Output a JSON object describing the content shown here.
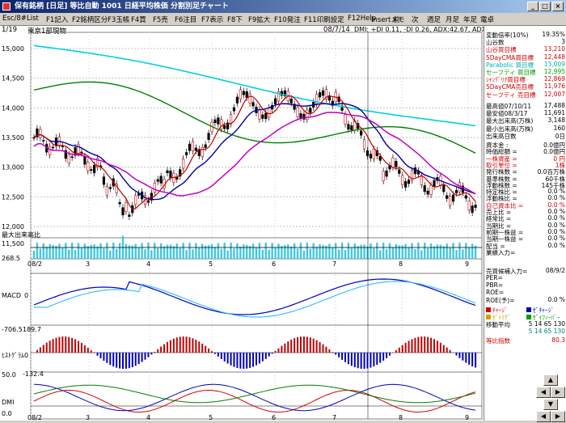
{
  "window": {
    "title": "保有銘柄 [日足] 等比自動  1001  日経平均株価 分割別足チャート"
  },
  "menu": [
    "Esc/8#",
    "List",
    "F1記入",
    "F2銘柄区分",
    "F3玉帳",
    "F4買",
    "F5売",
    "F6注目",
    "F7表示",
    "F8下",
    "F9拡大",
    "F10発注",
    "F11印刷設定",
    "F12Help",
    "Insertメモ",
    "前",
    "次",
    "週足",
    "月足",
    "年足",
    "電卓"
  ],
  "header": {
    "page": "1/19",
    "market": "東京1部現物",
    "date": "08/7/14",
    "dmi": "DMI: +DI 0.11, -DI 0.26, ADX:42.67, ADXR:33.58,"
  },
  "price_axis": {
    "ticks": [
      "15,000",
      "14,500",
      "14,000",
      "13,500",
      "13,000",
      "12,500",
      "12,000"
    ]
  },
  "volume_axis": {
    "label": "最大出来高比",
    "ticks": [
      "11,500",
      "268.5"
    ]
  },
  "macd": {
    "label": "MACD",
    "zero": "0",
    "low": "-706.5",
    "high": "189.7"
  },
  "hist": {
    "label": "ﾋｽﾄｸﾞﾗﾑ",
    "zero": "0",
    "low": "-132.4"
  },
  "dmi_panel": {
    "label": "DMI",
    "top": "50.0",
    "bottom": "0.0"
  },
  "date_axis": [
    "08/2",
    "3",
    "4",
    "5",
    "6",
    "7",
    "8",
    "9"
  ],
  "sidebar_top": [
    {
      "k": "変動倍率(10%)",
      "v": "19.35%",
      "c": "#000000"
    },
    {
      "k": "山谷数",
      "v": "3",
      "c": "#000000"
    },
    {
      "k": "山谷買目標",
      "v": "13,210",
      "c": "#d00000"
    },
    {
      "k": "5DayCMA買目標",
      "v": "12,448",
      "c": "#d00000"
    },
    {
      "k": "Parabolic 買目標",
      "v": "13,009",
      "c": "#00b0b0"
    },
    {
      "k": "セーフティ 買目標",
      "v": "12,995",
      "c": "#00a000"
    },
    {
      "k": "ｼｬﾝﾃﾞﾘｱ買目標",
      "v": "12,869",
      "c": "#d00000"
    },
    {
      "k": "5DayCMA売目標",
      "v": "11,976",
      "c": "#d00000"
    },
    {
      "k": "セーフティ 売目標",
      "v": "12,007",
      "c": "#d00000"
    }
  ],
  "sidebar_mid": [
    {
      "k": "最高値07/10/11",
      "v": "17,488"
    },
    {
      "k": "最安値08/3/17",
      "v": "11,691"
    },
    {
      "k": "最大出来高(万株)",
      "v": "3,148"
    },
    {
      "k": "最小出来高(万株)",
      "v": "160"
    },
    {
      "k": "出来高日数",
      "v": "0日"
    }
  ],
  "sidebar_fin": [
    {
      "k": "資本金 :",
      "v": "0.0億円",
      "c": "#000000"
    },
    {
      "k": "時価総額 =",
      "v": "0.0億円",
      "c": "#000000"
    },
    {
      "k": "一株資産 =",
      "v": "0 円",
      "c": "#d00000"
    },
    {
      "k": "取引単位 =",
      "v": "1株",
      "c": "#d00000"
    },
    {
      "k": "発行株数 =",
      "v": "0.0百万株",
      "c": "#000000"
    },
    {
      "k": "基準株数 =",
      "v": "60千株",
      "c": "#000000"
    },
    {
      "k": "浮動株数 =",
      "v": "145千株",
      "c": "#000000"
    },
    {
      "k": "特定株比 =",
      "v": "0.0 %",
      "c": "#000000"
    },
    {
      "k": "浮動株比 =",
      "v": "0.0 %",
      "c": "#000000"
    },
    {
      "k": "自己資本比 =",
      "v": "0.0 %",
      "c": "#d00000"
    },
    {
      "k": "売上比 =",
      "v": "0.0 %",
      "c": "#000000"
    },
    {
      "k": "経常比 =",
      "v": "0.0 %",
      "c": "#000000"
    },
    {
      "k": "当期比 =",
      "v": "0.0 %",
      "c": "#000000"
    },
    {
      "k": "前期一株益 =",
      "v": "0.0 %",
      "c": "#000000"
    },
    {
      "k": "当期一株益 =",
      "v": "0.0 %",
      "c": "#000000"
    },
    {
      "k": "配当 =",
      "v": "0.0 %",
      "c": "#000000"
    },
    {
      "k": "業績入力=",
      "v": "",
      "c": "#000000"
    }
  ],
  "sidebar_bottom": [
    {
      "k": "売買候補入力=",
      "v": "08/9/2",
      "c": "#000000"
    },
    {
      "k": "PER=",
      "v": "",
      "c": "#000000"
    },
    {
      "k": "PBR=",
      "v": "",
      "c": "#000000"
    },
    {
      "k": "ROE=",
      "v": "",
      "c": "#000000"
    },
    {
      "k": "ROE(予)=",
      "v": "0.0 %",
      "c": "#000000"
    }
  ],
  "legend": [
    {
      "label": "ﾁｬｰｼﾞ",
      "color": "#d00000"
    },
    {
      "label": "ｾﾞﾁｬｰｼﾞ",
      "color": "#0000c0"
    },
    {
      "label": "ｾﾞｲﾘｸﾞ",
      "color": "#d0a000"
    },
    {
      "label": "ｾﾞｲﾌｨｰﾊﾞｰ",
      "color": "#00a000"
    }
  ],
  "ma": {
    "label": "移動平均",
    "rows": [
      "5  14  65  130",
      "5  14  65  130"
    ]
  },
  "ratio": {
    "label": "等比指数",
    "value": "80.3"
  },
  "nav_buttons": [
    "▲",
    "◀",
    "▶",
    "▼",
    "◀",
    "▶"
  ]
}
